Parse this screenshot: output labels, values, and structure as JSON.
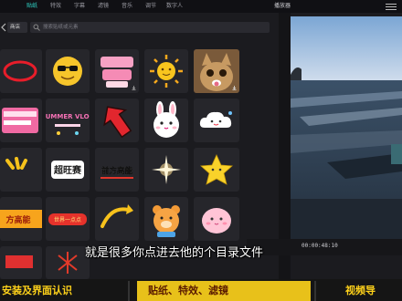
{
  "topbar": {
    "tabs": [
      {
        "label": "",
        "active": false
      },
      {
        "label": "贴纸",
        "active": true
      },
      {
        "label": "特效",
        "active": false
      },
      {
        "label": "字幕",
        "active": false
      },
      {
        "label": "滤镜",
        "active": false
      },
      {
        "label": "音乐",
        "active": false
      },
      {
        "label": "调节",
        "active": false
      },
      {
        "label": "数字人",
        "active": false
      }
    ],
    "preview_label": "播放器"
  },
  "left_panel": {
    "source_dropdown": "商店",
    "search_placeholder": "搜索贴纸或元素"
  },
  "stickers": [
    {
      "name": "red-ring-sticker"
    },
    {
      "name": "sunglasses-smiley-sticker"
    },
    {
      "name": "pink-3d-text-sticker"
    },
    {
      "name": "sun-sticker"
    },
    {
      "name": "cat-photo-sticker"
    },
    {
      "name": "red-dots-sticker"
    },
    {
      "name": "pink-bubble-sticker"
    },
    {
      "name": "summer-vlog-sticker",
      "text": "SUMMER VLOG"
    },
    {
      "name": "red-arrow-sticker"
    },
    {
      "name": "bunny-face-sticker"
    },
    {
      "name": "cloud-face-sticker"
    },
    {
      "name": "yellow-dashes-sticker"
    },
    {
      "name": "chaowangsai-text-sticker",
      "text": "超旺赛"
    },
    {
      "name": "qianfanggaoneng-sticker",
      "text": "前方高能"
    },
    {
      "name": "sparkle-sticker"
    },
    {
      "name": "yellow-star-sticker"
    },
    {
      "name": "wantiao-text-sticker",
      "text": "方高能"
    },
    {
      "name": "red-banner-sticker",
      "text": "世界一点点"
    },
    {
      "name": "yellow-arrow-sticker"
    },
    {
      "name": "bear-sticker"
    },
    {
      "name": "pink-blob-sticker"
    },
    {
      "name": "red-partial-sticker"
    },
    {
      "name": "red-firework-sticker"
    }
  ],
  "preview": {
    "timecode": "00:00:48:10"
  },
  "subtitle": "就是很多你点进去他的个目录文件",
  "bottom_nav": [
    {
      "label": "安装及界面认识",
      "active": false
    },
    {
      "label": "贴纸、特效、滤镜",
      "active": true
    },
    {
      "label": "视频导",
      "active": false
    }
  ],
  "colors": {
    "accent": "#30d5c8",
    "nav_text": "#ffd21a",
    "nav_active_bg": "#e8c11a"
  }
}
